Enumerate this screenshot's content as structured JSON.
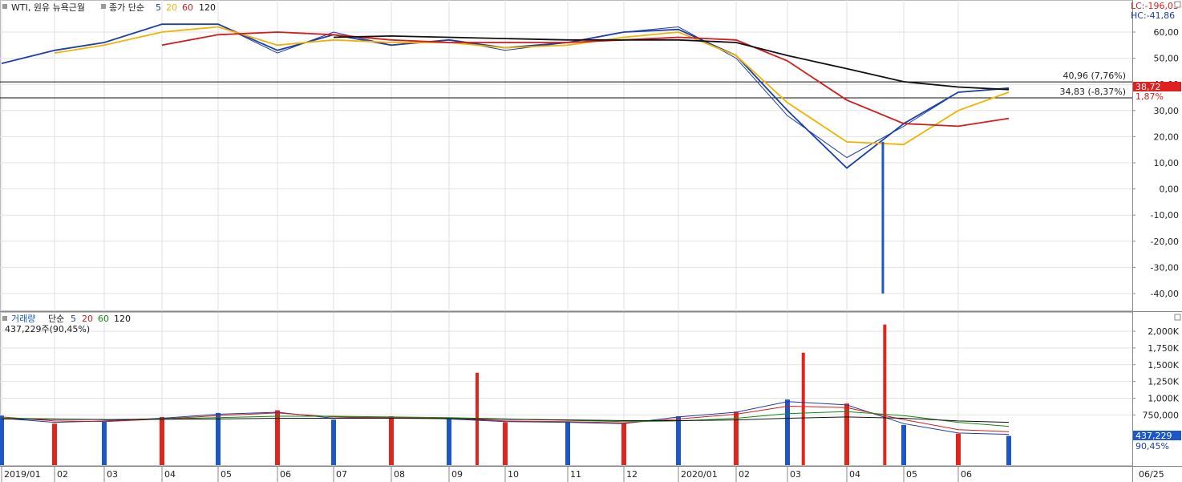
{
  "header": {
    "title": "WTI, 원유 뉴욕근월",
    "price_label": "종가 단순",
    "ma_periods": [
      "5",
      "20",
      "60",
      "120"
    ],
    "ma_colors": [
      "#1c3fa8",
      "#f2b300",
      "#d41c1c",
      "#111111"
    ],
    "lc": "LC:-196,03",
    "hc": "HC:-41,86"
  },
  "volume_header": {
    "title": "거래량",
    "avg_label": "단순",
    "ma_periods": [
      "5",
      "20",
      "60",
      "120"
    ],
    "ma_colors": [
      "#1c3fa8",
      "#d41c1c",
      "#118a11",
      "#111111"
    ],
    "value_text": "437,229주(90,45%)"
  },
  "chart_data": [
    {
      "type": "line",
      "title": "WTI, 원유 뉴욕근월",
      "x_ticks": [
        "2019/01",
        "02",
        "03",
        "04",
        "05",
        "06",
        "07",
        "08",
        "09",
        "10",
        "11",
        "12",
        "2020/01",
        "02",
        "03",
        "04",
        "05",
        "06"
      ],
      "y_ticks": [
        "60,00",
        "50,00",
        "40,00",
        "30,00",
        "20,00",
        "10,00",
        "0,00",
        "-10,00",
        "-20,00",
        "-30,00",
        "-40,00"
      ],
      "ylim": [
        -43,
        66
      ],
      "grid": true,
      "markers": [
        {
          "label": "40,96 (7,76%)",
          "value": 40.96
        },
        {
          "label": "34,83 (-8,37%)",
          "value": 34.83
        }
      ],
      "current_value_label": "38,72",
      "change_label": "1,87%",
      "series": [
        {
          "name": "종가",
          "color": "#1c3fa8",
          "x": [
            "2019/01",
            "2019/02",
            "2019/03",
            "2019/04",
            "2019/05",
            "2019/06",
            "2019/07",
            "2019/08",
            "2019/09",
            "2019/10",
            "2019/11",
            "2019/12",
            "2020/01",
            "2020/02",
            "2020/03",
            "2020/04",
            "2020/05",
            "2020/06",
            "2020/06/25"
          ],
          "values": [
            48,
            53,
            56,
            63,
            63,
            52,
            60,
            55,
            57,
            53,
            56,
            60,
            62,
            50,
            28,
            12,
            24,
            37,
            38.7
          ]
        },
        {
          "name": "5",
          "color": "#1c3fa8",
          "x": [
            "2019/01",
            "2019/02",
            "2019/03",
            "2019/04",
            "2019/05",
            "2019/06",
            "2019/07",
            "2019/08",
            "2019/09",
            "2019/10",
            "2019/11",
            "2019/12",
            "2020/01",
            "2020/02",
            "2020/03",
            "2020/04",
            "2020/05",
            "2020/06",
            "2020/06/25"
          ],
          "values": [
            48,
            53,
            56,
            63,
            63,
            53,
            59,
            55,
            57,
            54,
            56,
            60,
            61,
            51,
            30,
            8,
            25,
            37,
            38.5
          ]
        },
        {
          "name": "20",
          "color": "#f2b300",
          "x": [
            "2019/02",
            "2019/03",
            "2019/04",
            "2019/05",
            "2019/06",
            "2019/07",
            "2019/08",
            "2019/09",
            "2019/10",
            "2019/11",
            "2019/12",
            "2020/01",
            "2020/02",
            "2020/03",
            "2020/04",
            "2020/05",
            "2020/06",
            "2020/06/25"
          ],
          "values": [
            52,
            55,
            60,
            62,
            55,
            57,
            56,
            56,
            54,
            55,
            58,
            60,
            51,
            33,
            18,
            17,
            30,
            37
          ]
        },
        {
          "name": "60",
          "color": "#d41c1c",
          "x": [
            "2019/04",
            "2019/05",
            "2019/06",
            "2019/07",
            "2019/08",
            "2019/09",
            "2019/10",
            "2019/11",
            "2019/12",
            "2020/01",
            "2020/02",
            "2020/03",
            "2020/04",
            "2020/05",
            "2020/06",
            "2020/06/25"
          ],
          "values": [
            55,
            59,
            60,
            59,
            57,
            56,
            56,
            56,
            57,
            58,
            57,
            49,
            34,
            25,
            24,
            27
          ]
        },
        {
          "name": "120",
          "color": "#111111",
          "x": [
            "2019/07",
            "2019/08",
            "2019/09",
            "2019/10",
            "2019/11",
            "2019/12",
            "2020/01",
            "2020/02",
            "2020/03",
            "2020/04",
            "2020/05",
            "2020/06",
            "2020/06/25"
          ],
          "values": [
            58,
            58.5,
            58,
            57.5,
            57,
            57,
            57,
            56,
            51,
            46,
            41,
            39,
            38
          ]
        }
      ],
      "spike": {
        "date": "2020/04/20",
        "low": -40,
        "high": 18
      }
    },
    {
      "type": "bar",
      "title": "거래량",
      "y_ticks": [
        "2,000K",
        "1,750K",
        "1,500K",
        "1,250K",
        "1,000K",
        "750,000"
      ],
      "ylim": [
        0,
        2150000
      ],
      "current_value_label": "437,229",
      "percent_label": "90,45%",
      "x": [
        "2019/01",
        "2019/02",
        "2019/03",
        "2019/04",
        "2019/05",
        "2019/06",
        "2019/07",
        "2019/08",
        "2019/09",
        "2019/10",
        "2019/11",
        "2019/12",
        "2020/01",
        "2020/02",
        "2020/03",
        "2020/04",
        "2020/05",
        "2020/06",
        "2020/06/25"
      ],
      "values": [
        740000,
        620000,
        650000,
        720000,
        780000,
        820000,
        680000,
        730000,
        700000,
        640000,
        650000,
        620000,
        730000,
        800000,
        980000,
        920000,
        600000,
        470000,
        437229
      ],
      "peaks": [
        {
          "date": "2019/09/16",
          "value": 1380000
        },
        {
          "date": "2020/03/09",
          "value": 1680000
        },
        {
          "date": "2020/04/21",
          "value": 2100000
        }
      ],
      "series": [
        {
          "name": "5",
          "color": "#1c3fa8",
          "values": [
            700000,
            640000,
            660000,
            700000,
            760000,
            790000,
            700000,
            720000,
            690000,
            650000,
            640000,
            620000,
            720000,
            790000,
            950000,
            900000,
            620000,
            480000,
            460000
          ]
        },
        {
          "name": "20",
          "color": "#d41c1c",
          "values": [
            720000,
            660000,
            650000,
            690000,
            740000,
            780000,
            720000,
            710000,
            700000,
            660000,
            650000,
            630000,
            690000,
            760000,
            880000,
            860000,
            680000,
            530000,
            500000
          ]
        },
        {
          "name": "60",
          "color": "#118a11",
          "values": [
            700000,
            690000,
            680000,
            690000,
            710000,
            730000,
            730000,
            720000,
            710000,
            690000,
            670000,
            650000,
            660000,
            700000,
            770000,
            800000,
            740000,
            640000,
            580000
          ]
        },
        {
          "name": "120",
          "color": "#111111",
          "values": [
            690000,
            685000,
            680000,
            685000,
            690000,
            700000,
            700000,
            700000,
            695000,
            685000,
            675000,
            665000,
            665000,
            675000,
            700000,
            720000,
            700000,
            660000,
            640000
          ]
        }
      ]
    }
  ]
}
